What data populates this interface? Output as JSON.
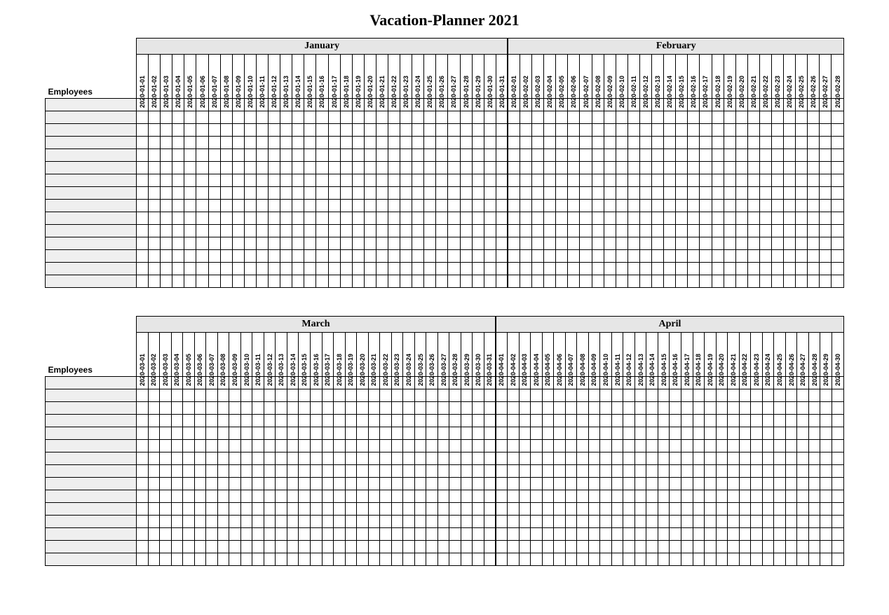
{
  "title": "Vacation-Planner 2021",
  "employees_label": "Employees",
  "employee_rows": 15,
  "blocks": [
    {
      "months": [
        {
          "name": "January",
          "days": [
            "2020-01-01",
            "2020-01-02",
            "2020-01-03",
            "2020-01-04",
            "2020-01-05",
            "2020-01-06",
            "2020-01-07",
            "2020-01-08",
            "2020-01-09",
            "2020-01-10",
            "2020-01-11",
            "2020-01-12",
            "2020-01-13",
            "2020-01-14",
            "2020-01-15",
            "2020-01-16",
            "2020-01-17",
            "2020-01-18",
            "2020-01-19",
            "2020-01-20",
            "2020-01-21",
            "2020-01-22",
            "2020-01-23",
            "2020-01-24",
            "2020-01-25",
            "2020-01-26",
            "2020-01-27",
            "2020-01-28",
            "2020-01-29",
            "2020-01-30",
            "2020-01-31"
          ]
        },
        {
          "name": "February",
          "days": [
            "2020-02-01",
            "2020-02-02",
            "2020-02-03",
            "2020-02-04",
            "2020-02-05",
            "2020-02-06",
            "2020-02-07",
            "2020-02-08",
            "2020-02-09",
            "2020-02-10",
            "2020-02-11",
            "2020-02-12",
            "2020-02-13",
            "2020-02-14",
            "2020-02-15",
            "2020-02-16",
            "2020-02-17",
            "2020-02-18",
            "2020-02-19",
            "2020-02-20",
            "2020-02-21",
            "2020-02-22",
            "2020-02-23",
            "2020-02-24",
            "2020-02-25",
            "2020-02-26",
            "2020-02-27",
            "2020-02-28"
          ]
        }
      ]
    },
    {
      "months": [
        {
          "name": "March",
          "days": [
            "2020-03-01",
            "2020-03-02",
            "2020-03-03",
            "2020-03-04",
            "2020-03-05",
            "2020-03-06",
            "2020-03-07",
            "2020-03-08",
            "2020-03-09",
            "2020-03-10",
            "2020-03-11",
            "2020-03-12",
            "2020-03-13",
            "2020-03-14",
            "2020-03-15",
            "2020-03-16",
            "2020-03-17",
            "2020-03-18",
            "2020-03-19",
            "2020-03-20",
            "2020-03-21",
            "2020-03-22",
            "2020-03-23",
            "2020-03-24",
            "2020-03-25",
            "2020-03-26",
            "2020-03-27",
            "2020-03-28",
            "2020-03-29",
            "2020-03-30",
            "2020-03-31"
          ]
        },
        {
          "name": "April",
          "days": [
            "2020-04-01",
            "2020-04-02",
            "2020-04-03",
            "2020-04-04",
            "2020-04-05",
            "2020-04-06",
            "2020-04-07",
            "2020-04-08",
            "2020-04-09",
            "2020-04-10",
            "2020-04-11",
            "2020-04-12",
            "2020-04-13",
            "2020-04-14",
            "2020-04-15",
            "2020-04-16",
            "2020-04-17",
            "2020-04-18",
            "2020-04-19",
            "2020-04-20",
            "2020-04-21",
            "2020-04-22",
            "2020-04-23",
            "2020-04-24",
            "2020-04-25",
            "2020-04-26",
            "2020-04-27",
            "2020-04-28",
            "2020-04-29",
            "2020-04-30"
          ]
        }
      ]
    }
  ]
}
